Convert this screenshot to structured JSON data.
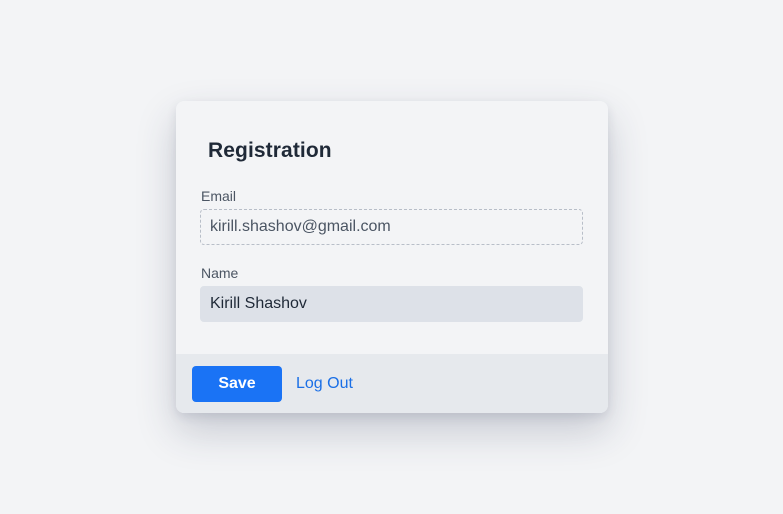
{
  "form": {
    "title": "Registration",
    "email_label": "Email",
    "email_value": "kirill.shashov@gmail.com",
    "name_label": "Name",
    "name_value": "Kirill Shashov"
  },
  "footer": {
    "save_label": "Save",
    "logout_label": "Log Out"
  },
  "colors": {
    "page_background": "#f3f4f6",
    "accent": "#1a73f5",
    "link": "#1a6fe6",
    "footer_background": "#e6e9ed"
  }
}
